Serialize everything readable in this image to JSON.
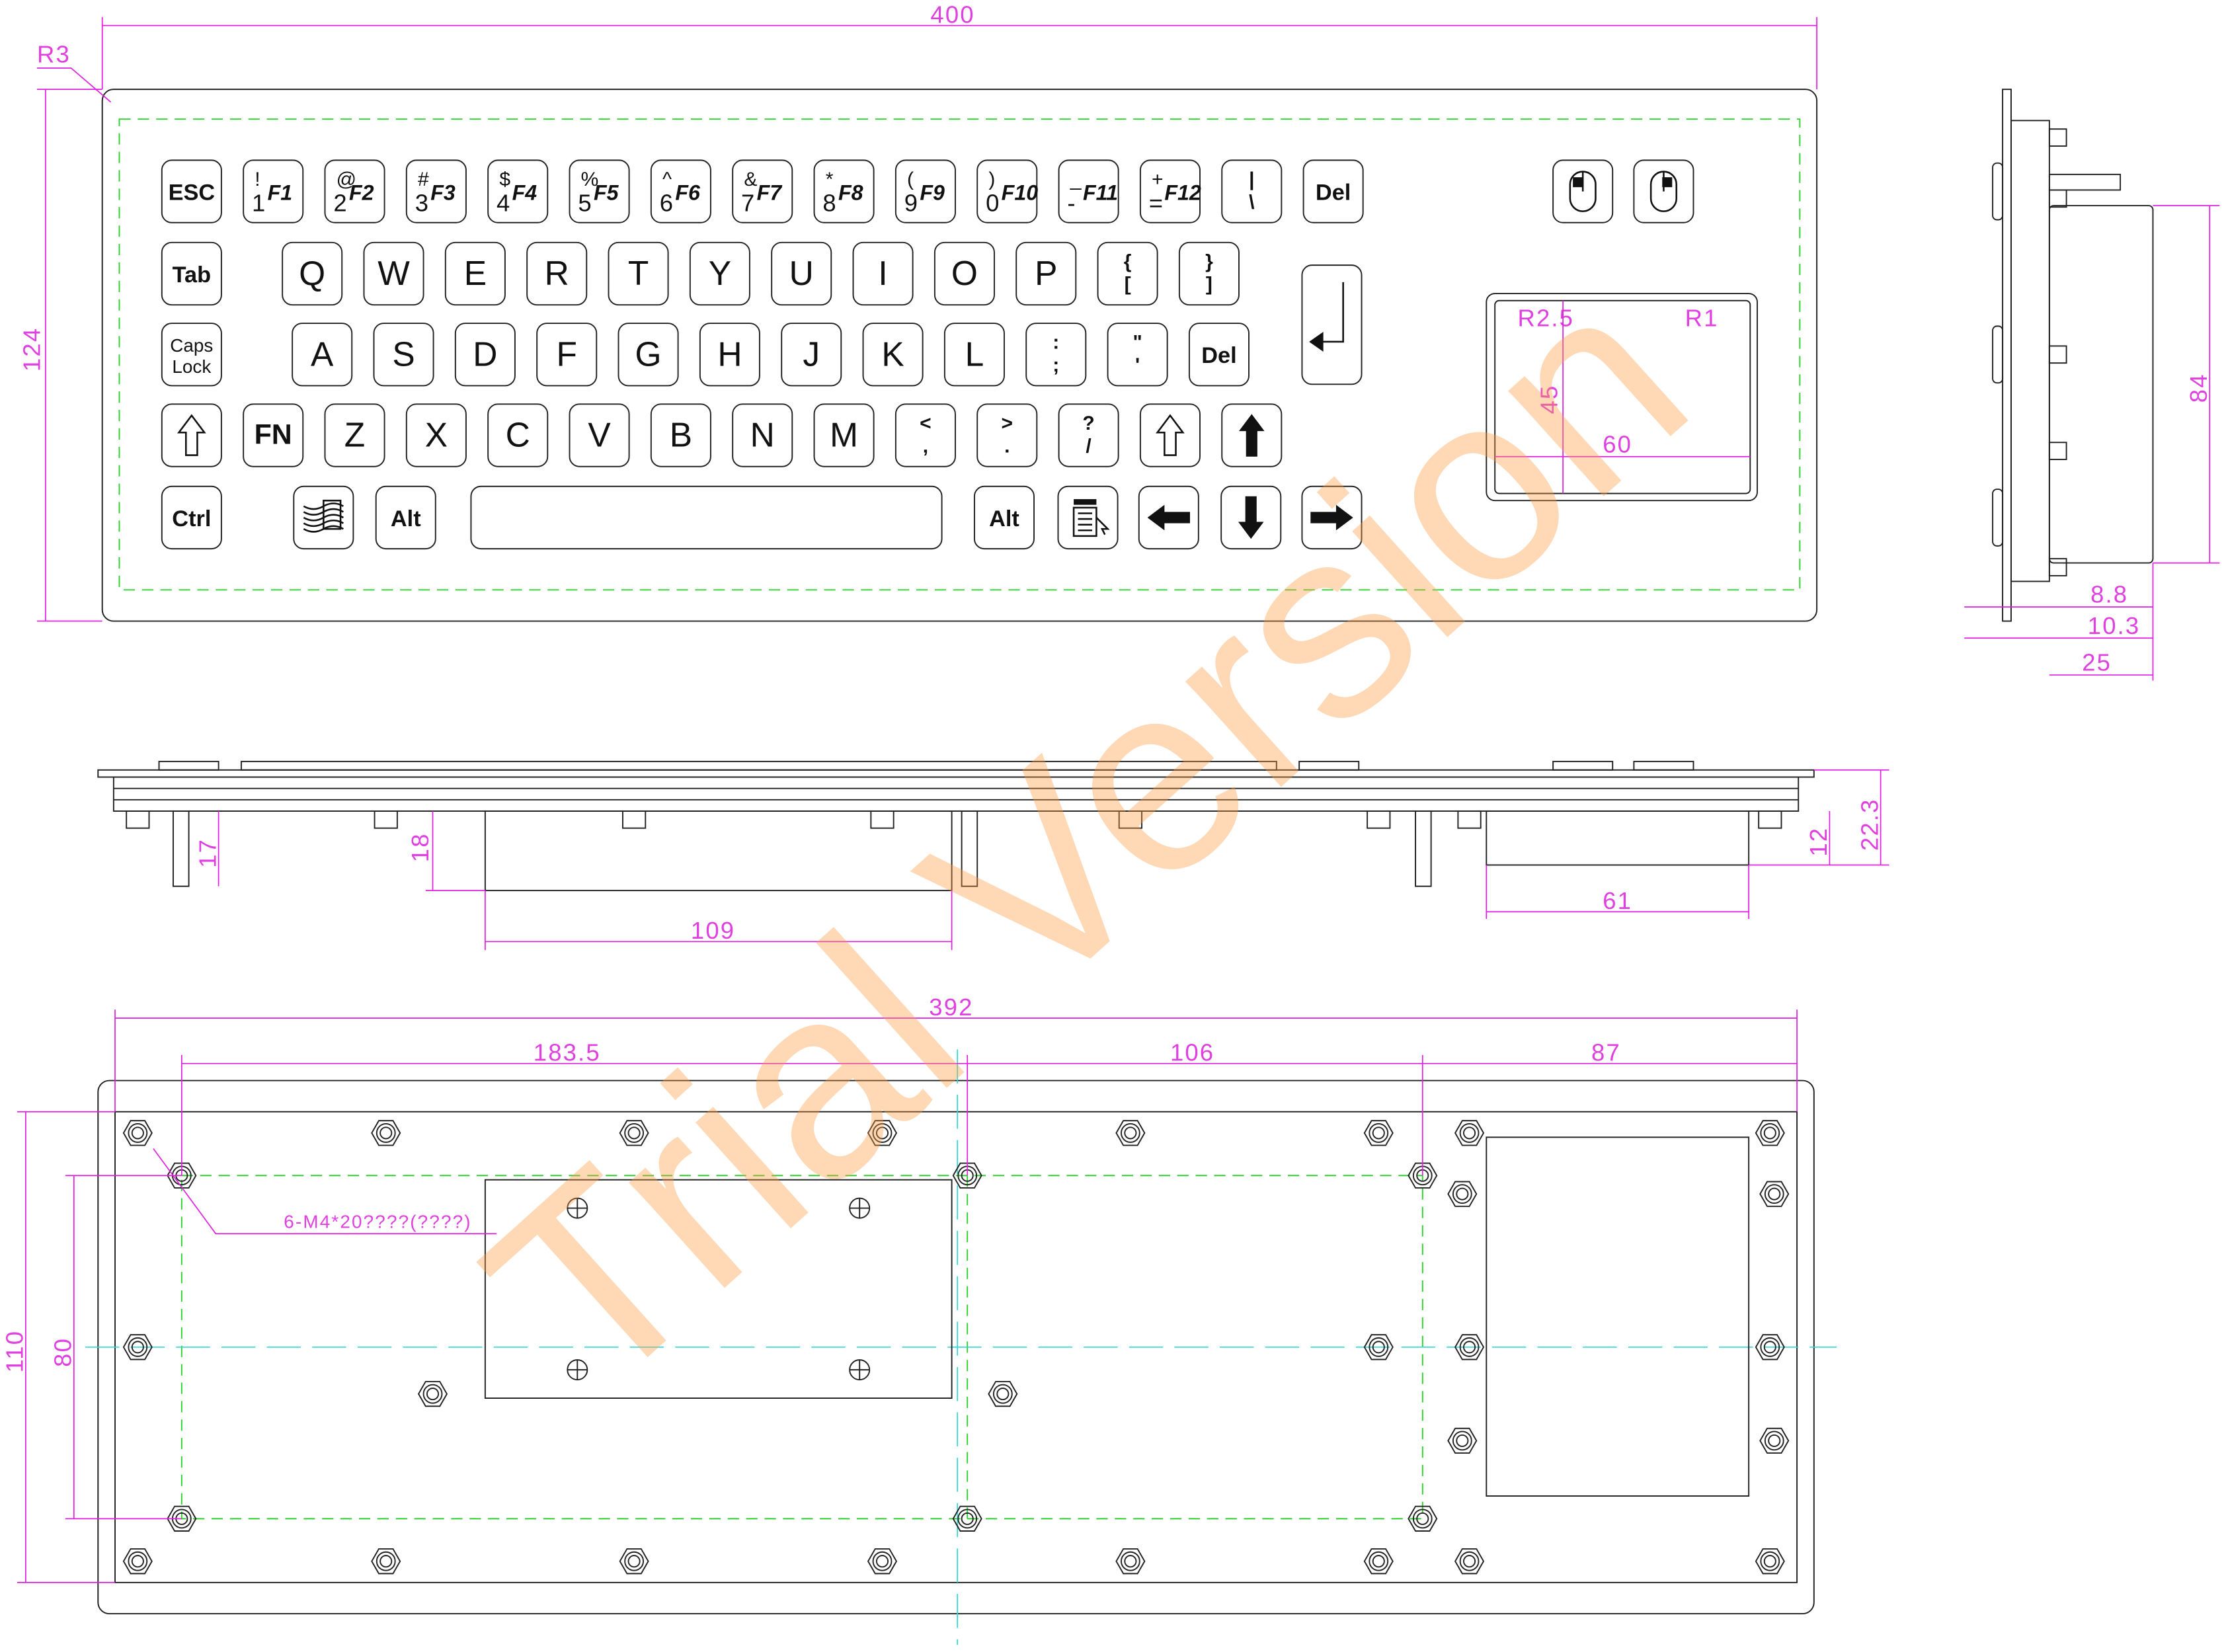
{
  "keyboard": {
    "row1": [
      "ESC",
      "F1",
      "F2",
      "F3",
      "F4",
      "F5",
      "F6",
      "F7",
      "F8",
      "F9",
      "F10",
      "F11",
      "F12",
      "| \\",
      "Del"
    ],
    "row1_shift": [
      "",
      "! 1",
      "@ 2",
      "# 3",
      "$ 4",
      "% 5",
      "^ 6",
      "& 7",
      "* 8",
      "( 9",
      ") 0",
      "_ -",
      "+ =",
      "",
      ""
    ],
    "row2": [
      "Tab",
      "Q",
      "W",
      "E",
      "R",
      "T",
      "Y",
      "U",
      "I",
      "O",
      "P",
      "{ [",
      "} ]"
    ],
    "row3": [
      "Caps Lock",
      "A",
      "S",
      "D",
      "F",
      "G",
      "H",
      "J",
      "K",
      "L",
      ": ;",
      "\" '",
      "Del"
    ],
    "row4": [
      "shift-arrow",
      "FN",
      "Z",
      "X",
      "C",
      "V",
      "B",
      "N",
      "M",
      "< ,",
      "> .",
      "? /",
      "shift-arrow",
      "arrow-up"
    ],
    "row5": [
      "Ctrl",
      "windows-icon",
      "Alt",
      "space",
      "Alt",
      "menu-icon",
      "arrow-left",
      "arrow-down",
      "arrow-right"
    ],
    "enter": "enter-arrow",
    "mouse_buttons": [
      "left-mouse-button",
      "right-mouse-button"
    ]
  },
  "dimensions": {
    "top_width": "400",
    "corner_radius": "R3",
    "top_height": "124",
    "touchpad_r_outer": "R2.5",
    "touchpad_r_inner": "R1",
    "touchpad_height": "45",
    "touchpad_width": "60",
    "side_height": "84",
    "side_a": "8.8",
    "side_b": "10.3",
    "side_c": "25",
    "front_leg": "17",
    "front_block_h": "18",
    "front_block_w": "109",
    "front_pad_w": "61",
    "front_pad_h": "12",
    "front_total_h": "22.3",
    "bottom_width": "392",
    "bottom_seg1": "183.5",
    "bottom_seg2": "106",
    "bottom_seg3": "87",
    "bottom_height": "110",
    "bottom_inner_h": "80",
    "screw_note": "6-M4*20????(????)"
  },
  "watermark": "Trial Version",
  "colors": {
    "dimension": "#e020e0",
    "hidden_line": "#30d030",
    "center_line": "#30d8d8",
    "watermark": "#ff9a40"
  }
}
